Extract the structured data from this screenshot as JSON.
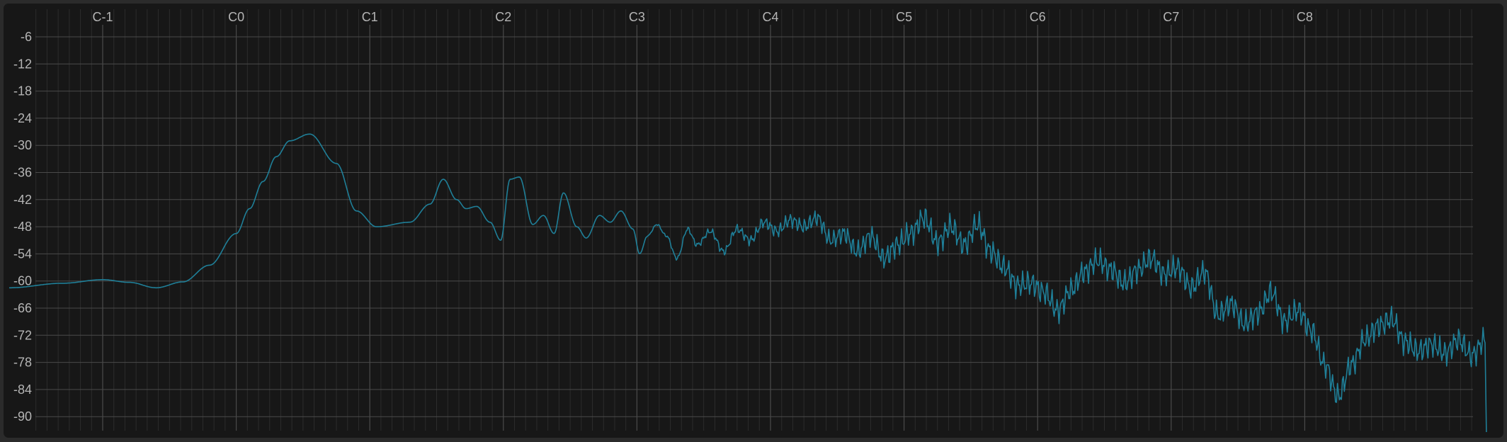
{
  "chart_data": {
    "type": "line",
    "title": "",
    "xlabel": "",
    "ylabel": "",
    "x_scale": "log (note names)",
    "x_tick_labels": [
      "C-1",
      "C0",
      "C1",
      "C2",
      "C3",
      "C4",
      "C5",
      "C6",
      "C7",
      "C8"
    ],
    "y_tick_labels": [
      "-6",
      "-12",
      "-18",
      "-24",
      "-30",
      "-36",
      "-42",
      "-48",
      "-54",
      "-60",
      "-66",
      "-72",
      "-78",
      "-84",
      "-90"
    ],
    "y_ticks": [
      -6,
      -12,
      -18,
      -24,
      -30,
      -36,
      -42,
      -48,
      -54,
      -60,
      -66,
      -72,
      -78,
      -84,
      -90
    ],
    "ylim": [
      -90,
      -3
    ],
    "xlim_octaves": [
      -1.7,
      9.4
    ],
    "grid": true,
    "legend": "none",
    "colors": {
      "background": "#171717",
      "frame": "#2b2b2b",
      "grid_major": "#4a4a4a",
      "grid_minor": "#2c2c2c",
      "tick_text": "#b5b5b5",
      "series": "#1f7f98"
    },
    "series": [
      {
        "x_octave": [
          -1.7,
          -1.3,
          -1.0,
          -0.8,
          -0.6,
          -0.4,
          -0.2,
          0.0,
          0.1,
          0.2,
          0.3,
          0.4,
          0.55,
          0.75,
          0.9,
          1.05,
          1.3,
          1.45,
          1.55,
          1.65,
          1.72,
          1.8,
          1.9,
          1.98,
          2.05,
          2.12,
          2.22,
          2.3,
          2.38,
          2.45,
          2.55,
          2.62,
          2.72,
          2.8,
          2.88,
          2.97,
          3.02,
          3.08,
          3.15,
          3.22,
          3.3,
          3.38,
          3.45,
          3.55,
          3.65,
          3.75,
          3.85,
          3.95,
          4.05,
          4.15,
          4.25,
          4.35,
          4.45,
          4.55,
          4.65,
          4.75,
          4.85,
          4.95,
          5.05,
          5.15,
          5.25,
          5.35,
          5.45,
          5.55,
          5.65,
          5.75,
          5.85,
          5.95,
          6.05,
          6.15,
          6.25,
          6.35,
          6.45,
          6.55,
          6.65,
          6.75,
          6.85,
          6.95,
          7.05,
          7.15,
          7.25,
          7.35,
          7.45,
          7.55,
          7.65,
          7.75,
          7.85,
          7.95,
          8.05,
          8.15,
          8.25,
          8.35,
          8.45,
          8.55,
          8.65,
          8.75,
          8.85,
          8.95,
          9.05,
          9.15,
          9.25,
          9.35
        ],
        "y_db": [
          -61.5,
          -60.5,
          -59.7,
          -60.3,
          -61.5,
          -60.2,
          -56.5,
          -49.5,
          -44.0,
          -38.0,
          -32.5,
          -29.0,
          -27.5,
          -34.0,
          -44.5,
          -48.0,
          -47.0,
          -43.0,
          -37.5,
          -42.0,
          -44.0,
          -43.5,
          -47.0,
          -51.0,
          -37.5,
          -37.0,
          -47.5,
          -45.5,
          -49.5,
          -40.5,
          -48.0,
          -50.5,
          -45.5,
          -47.0,
          -44.5,
          -48.5,
          -54.0,
          -50.0,
          -47.5,
          -50.0,
          -55.0,
          -48.5,
          -52.0,
          -49.0,
          -53.5,
          -48.5,
          -51.0,
          -47.0,
          -49.0,
          -46.5,
          -48.0,
          -46.0,
          -51.0,
          -49.5,
          -53.5,
          -50.0,
          -55.0,
          -52.0,
          -49.5,
          -46.0,
          -51.5,
          -48.0,
          -52.0,
          -47.5,
          -53.5,
          -57.0,
          -61.0,
          -60.5,
          -62.5,
          -66.5,
          -62.0,
          -58.0,
          -55.5,
          -57.5,
          -60.5,
          -57.5,
          -55.0,
          -58.5,
          -57.0,
          -61.5,
          -58.0,
          -67.5,
          -65.0,
          -69.5,
          -67.0,
          -62.5,
          -69.0,
          -66.5,
          -71.0,
          -78.5,
          -85.5,
          -78.5,
          -73.0,
          -70.0,
          -68.5,
          -73.5,
          -75.5,
          -74.0,
          -76.0,
          -73.0,
          -76.5,
          -73.0
        ]
      }
    ]
  }
}
